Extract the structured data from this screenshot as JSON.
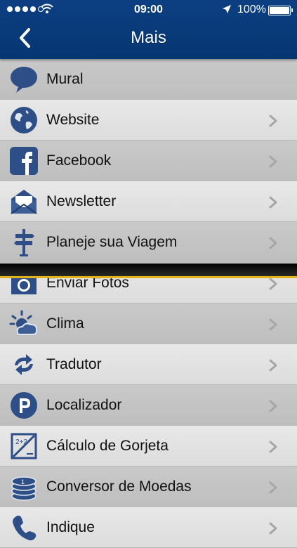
{
  "status_bar": {
    "time": "09:00",
    "battery": "100%"
  },
  "header": {
    "title": "Mais"
  },
  "menu": {
    "items": [
      {
        "label": "Mural",
        "icon": "speech-bubble-icon",
        "chevron": false
      },
      {
        "label": "Website",
        "icon": "globe-icon",
        "chevron": true
      },
      {
        "label": "Facebook",
        "icon": "facebook-icon",
        "chevron": true
      },
      {
        "label": "Newsletter",
        "icon": "envelope-icon",
        "chevron": true
      },
      {
        "label": "Planeje sua Viagem",
        "icon": "signpost-icon",
        "chevron": true
      },
      {
        "label": "Enviar Fotos",
        "icon": "camera-icon",
        "chevron": true
      },
      {
        "label": "Clima",
        "icon": "weather-icon",
        "chevron": true
      },
      {
        "label": "Tradutor",
        "icon": "translate-arrows-icon",
        "chevron": true
      },
      {
        "label": "Localizador",
        "icon": "parking-icon",
        "chevron": true
      },
      {
        "label": "Cálculo de Gorjeta",
        "icon": "calculator-icon",
        "chevron": true
      },
      {
        "label": "Conversor de Moedas",
        "icon": "coins-icon",
        "chevron": true
      },
      {
        "label": "Indique",
        "icon": "phone-icon",
        "chevron": true
      }
    ]
  },
  "colors": {
    "nav_bar": "#083a78",
    "icon_blue": "#2d4e86",
    "divider_accent": "#e3b21b"
  }
}
